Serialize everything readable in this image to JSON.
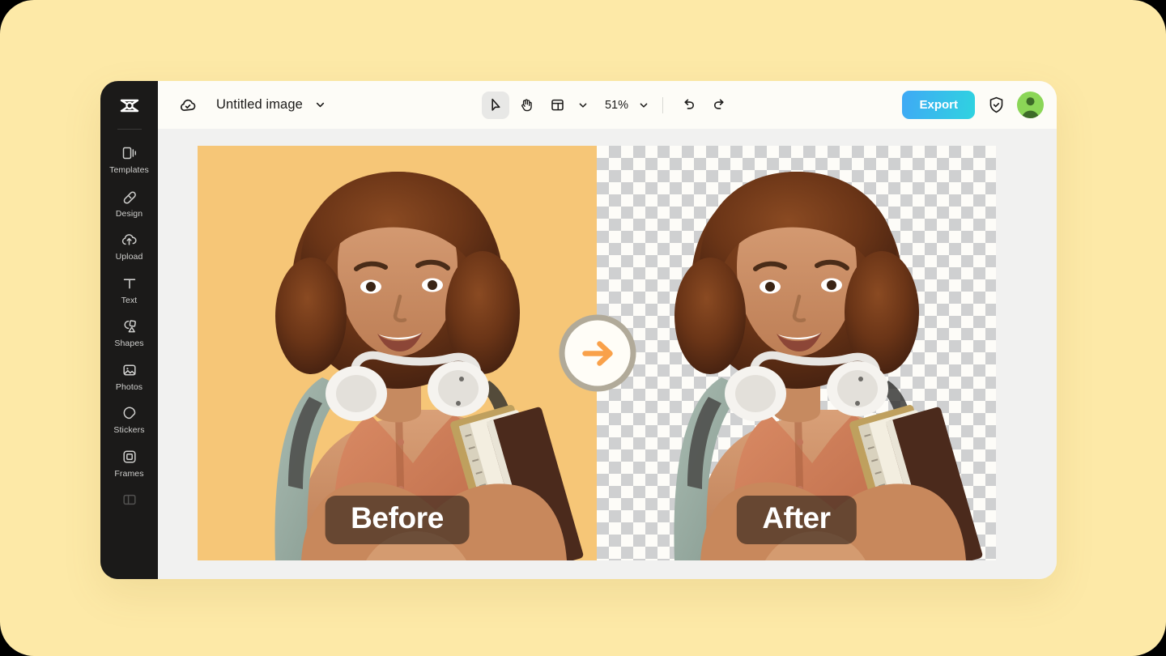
{
  "page": {
    "backdrop_color": "#FDE9A7"
  },
  "app": {
    "window_bg": "#F1F1F0",
    "rail": {
      "logo_name": "capcut-logo-icon",
      "items": [
        {
          "label": "Templates",
          "icon": "templates-icon"
        },
        {
          "label": "Design",
          "icon": "design-icon"
        },
        {
          "label": "Upload",
          "icon": "upload-cloud-icon"
        },
        {
          "label": "Text",
          "icon": "text-icon"
        },
        {
          "label": "Shapes",
          "icon": "shapes-icon"
        },
        {
          "label": "Photos",
          "icon": "photos-icon"
        },
        {
          "label": "Stickers",
          "icon": "stickers-icon"
        },
        {
          "label": "Frames",
          "icon": "frames-icon"
        },
        {
          "label": "",
          "icon": "background-icon"
        }
      ]
    },
    "header": {
      "bg_color": "#FDFCF7",
      "cloud_status_icon": "cloud-saved-icon",
      "document_title": "Untitled image",
      "title_caret_icon": "chevron-down-icon",
      "tools": {
        "select_icon": "cursor-select-icon",
        "select_active": true,
        "hand_icon": "hand-pan-icon",
        "layout_icon": "resize-layout-icon",
        "layout_caret_icon": "chevron-down-icon",
        "zoom_level": "51%",
        "zoom_caret_icon": "chevron-down-icon",
        "undo_icon": "undo-icon",
        "redo_icon": "redo-icon"
      },
      "export_label": "Export",
      "export_gradient_from": "#3FA9F5",
      "export_gradient_to": "#2FD3E0",
      "shield_icon": "shield-check-icon",
      "avatar_icon": "user-avatar",
      "avatar_color": "#8BD657"
    },
    "canvas": {
      "panels": [
        {
          "caption": "Before",
          "background": "#F6C677",
          "background_kind": "solid-orange"
        },
        {
          "caption": "After",
          "background": "#FDFCF8",
          "background_kind": "transparent-checkerboard"
        }
      ],
      "arrow_badge_icon": "arrow-right-icon",
      "arrow_color": "#F9A14A"
    }
  }
}
